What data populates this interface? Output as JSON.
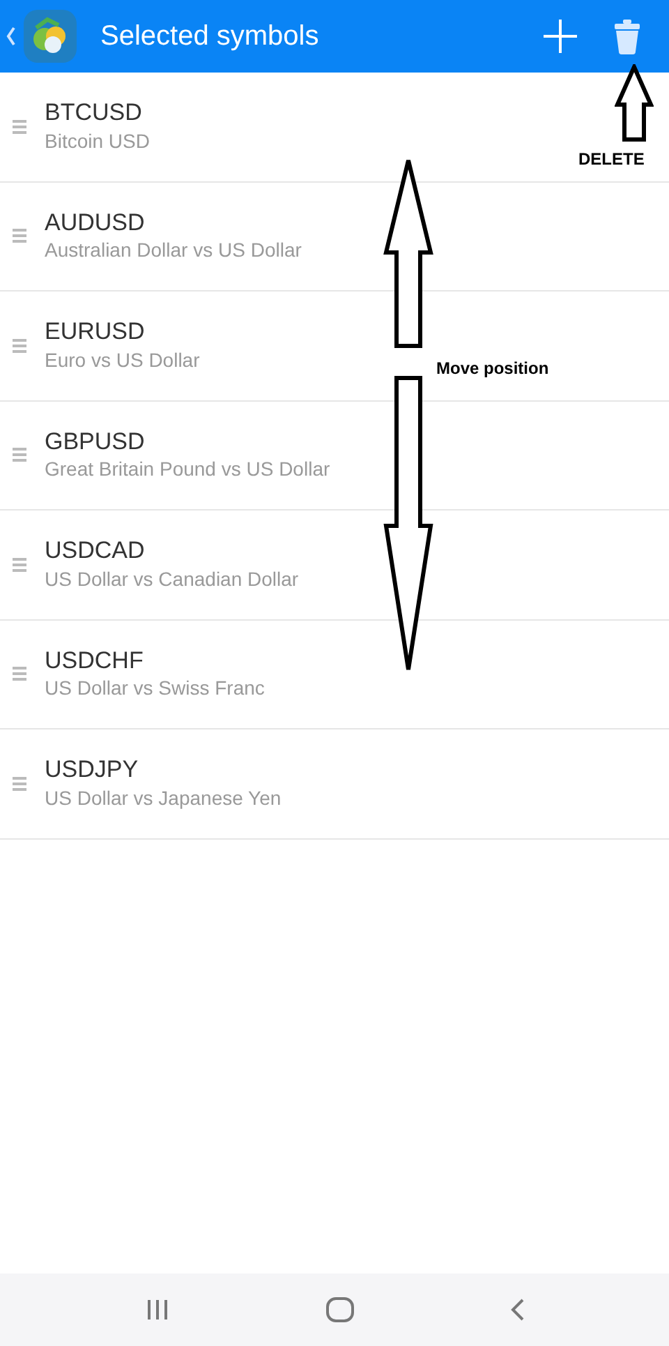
{
  "header": {
    "title": "Selected symbols"
  },
  "symbols": [
    {
      "symbol": "BTCUSD",
      "description": "Bitcoin USD"
    },
    {
      "symbol": "AUDUSD",
      "description": "Australian Dollar vs US Dollar"
    },
    {
      "symbol": "EURUSD",
      "description": "Euro vs US Dollar"
    },
    {
      "symbol": "GBPUSD",
      "description": "Great Britain Pound vs US Dollar"
    },
    {
      "symbol": "USDCAD",
      "description": "US Dollar vs Canadian Dollar"
    },
    {
      "symbol": "USDCHF",
      "description": "US Dollar vs Swiss Franc"
    },
    {
      "symbol": "USDJPY",
      "description": "US Dollar vs Japanese Yen"
    }
  ],
  "annotations": [
    {
      "kind": "delete",
      "label": "DELETE"
    },
    {
      "kind": "move",
      "label": "Move position"
    }
  ]
}
